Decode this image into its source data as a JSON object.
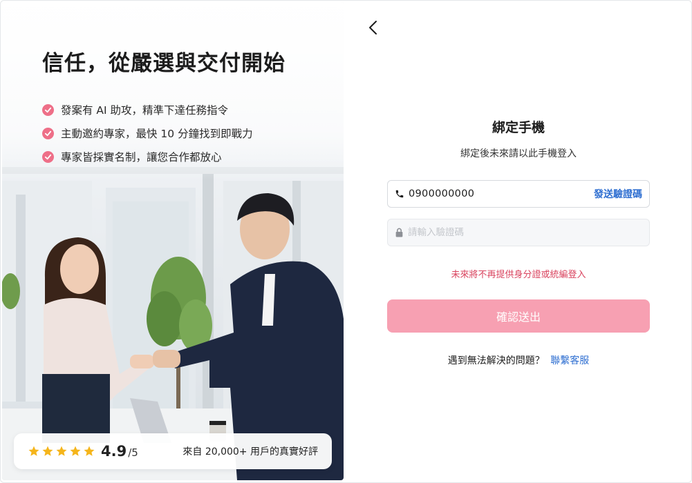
{
  "hero": {
    "headline": "信任，從嚴選與交付開始",
    "features": [
      "發案有 AI 助攻，精準下達任務指令",
      "主動邀約專家，最快 10 分鐘找到即戰力",
      "專家皆採實名制，讓您合作都放心"
    ],
    "rating": {
      "stars": 5,
      "value": "4.9",
      "max": "/5",
      "review_text": "來自 20,000+ 用戶的真實好評"
    }
  },
  "form": {
    "title": "綁定手機",
    "subtitle": "綁定後未來請以此手機登入",
    "phone_value": "0900000000",
    "send_code_label": "發送驗證碼",
    "code_placeholder": "請輸入驗證碼",
    "notice": "未來將不再提供身分證或統編登入",
    "submit_label": "確認送出",
    "help_prefix": "遇到無法解決的問題？",
    "contact_label": "聯繫客服"
  },
  "colors": {
    "accent_pink": "#ee6f88",
    "submit_bg": "#f7a0b2",
    "link_blue": "#2f6fd1",
    "notice_red": "#d9435e",
    "star_gold": "#f5b51b"
  }
}
